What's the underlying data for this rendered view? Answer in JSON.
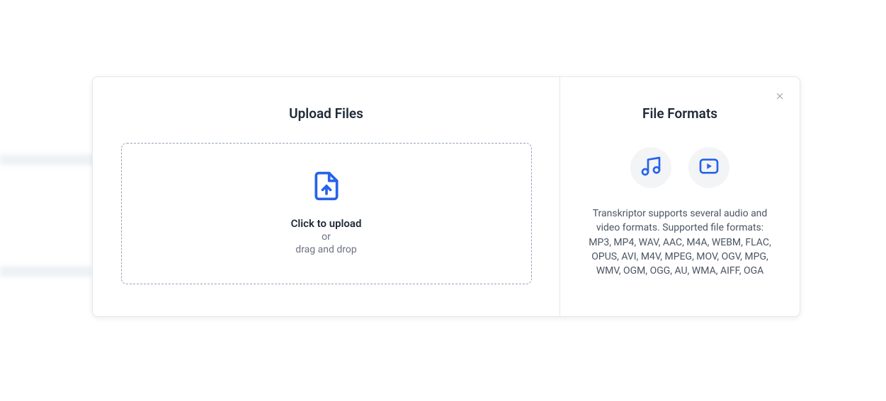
{
  "upload": {
    "title": "Upload Files",
    "primary": "Click to upload",
    "or": "or",
    "secondary": "drag and drop"
  },
  "formats": {
    "title": "File Formats",
    "description": "Transkriptor supports several audio and video formats. Supported file formats: MP3, MP4, WAV, AAC, M4A, WEBM, FLAC, OPUS, AVI, M4V, MPEG, MOV, OGV, MPG, WMV, OGM, OGG, AU, WMA, AIFF, OGA"
  }
}
